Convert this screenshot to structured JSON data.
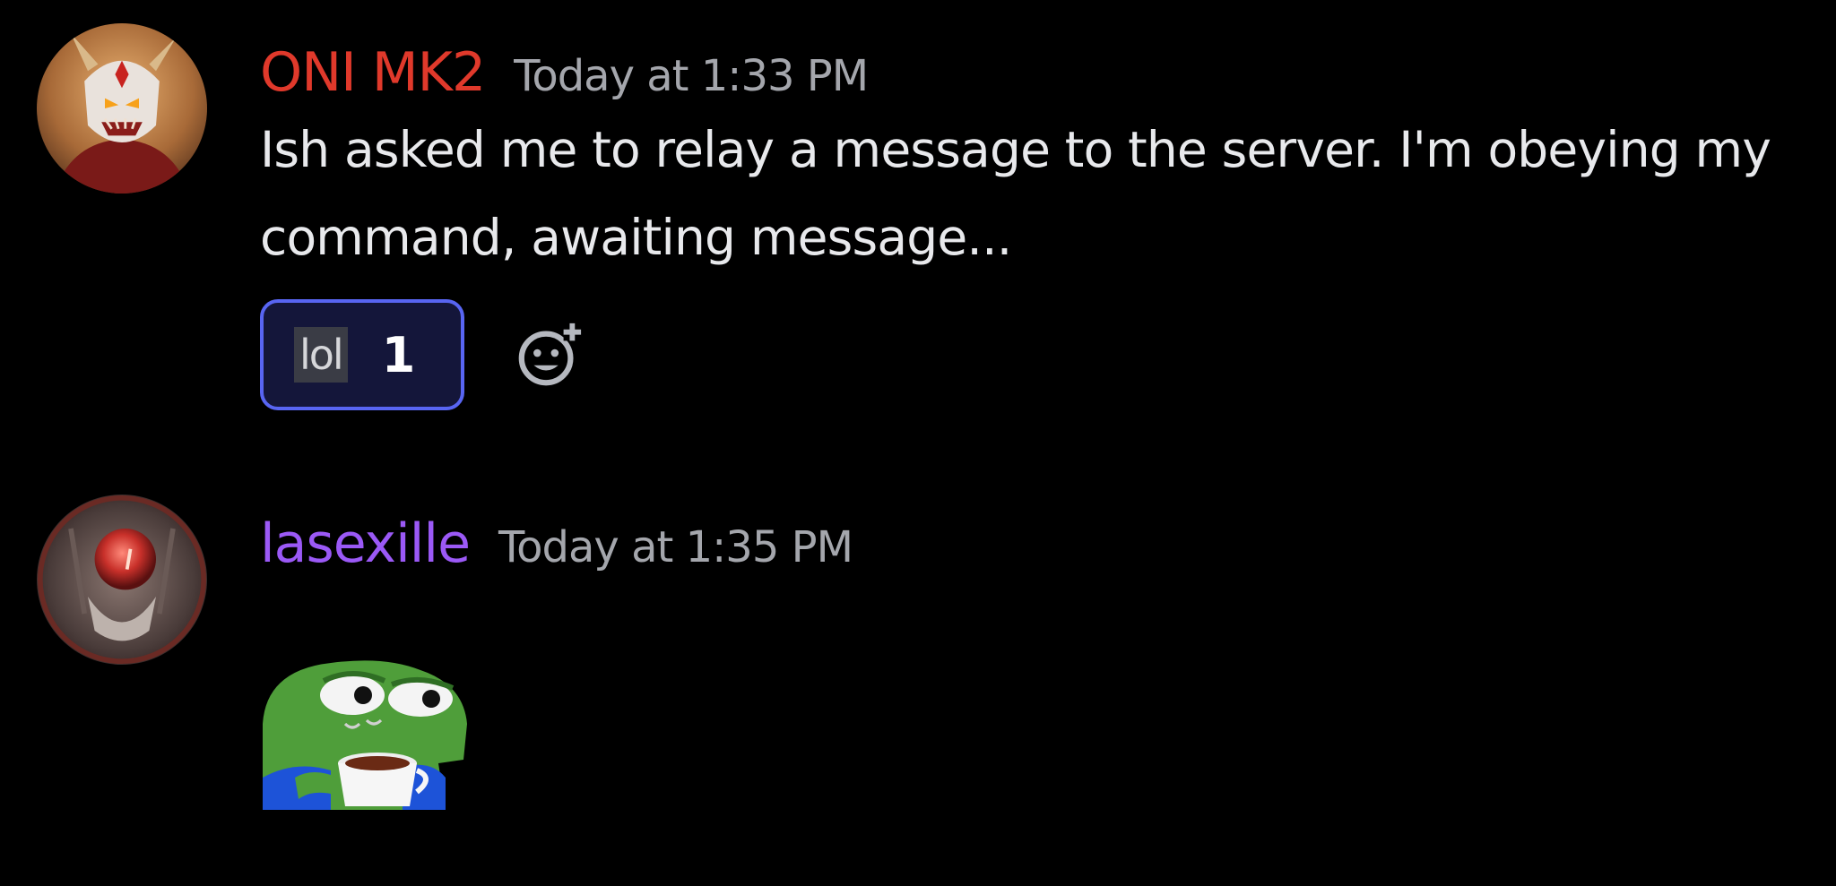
{
  "messages": [
    {
      "username": "ONI MK2",
      "username_color": "#e0392b",
      "timestamp": "Today at 1:33 PM",
      "content": "Ish asked me to relay a message to the server. I'm obeying my command, awaiting message...",
      "avatar_icon": "oni-mask-avatar",
      "reactions": [
        {
          "emoji": "lol",
          "count": "1",
          "active": true
        }
      ]
    },
    {
      "username": "lasexille",
      "username_color": "#9b59f6",
      "timestamp": "Today at 1:35 PM",
      "avatar_icon": "red-orb-avatar",
      "sticker_icon": "pepe-coffee-sticker"
    }
  ],
  "icons": {
    "add_reaction": "add-reaction-icon"
  }
}
